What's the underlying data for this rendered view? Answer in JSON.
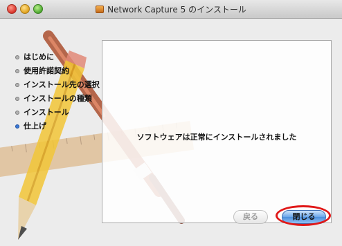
{
  "window": {
    "title": "Network Capture 5 のインストール"
  },
  "sidebar": {
    "steps": [
      {
        "label": "はじめに",
        "active": false
      },
      {
        "label": "使用許諾契約",
        "active": false
      },
      {
        "label": "インストール先の選択",
        "active": false
      },
      {
        "label": "インストールの種類",
        "active": false
      },
      {
        "label": "インストール",
        "active": false
      },
      {
        "label": "仕上げ",
        "active": true
      }
    ]
  },
  "main": {
    "message": "ソフトウェアは正常にインストールされました"
  },
  "footer": {
    "back_label": "戻る",
    "close_label": "閉じる"
  },
  "colors": {
    "accent": "#3a7ad6",
    "highlight": "#e01818"
  }
}
